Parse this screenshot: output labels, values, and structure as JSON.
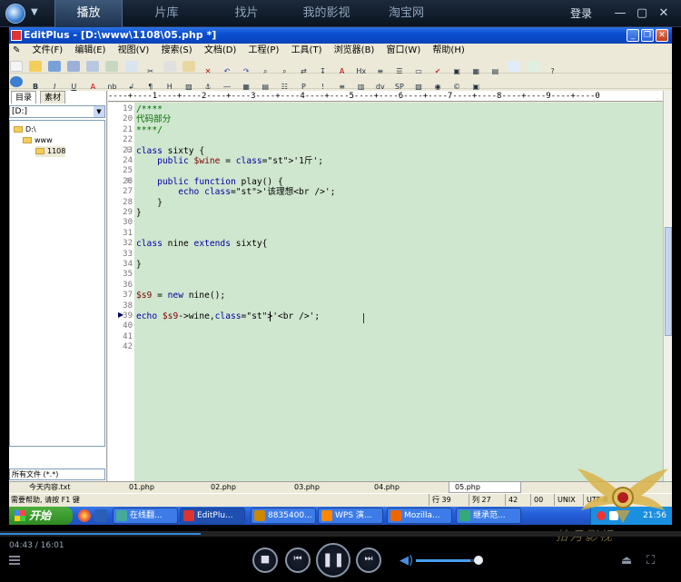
{
  "player": {
    "tabs": [
      {
        "label": "播放",
        "active": true
      },
      {
        "label": "片库"
      },
      {
        "label": "找片"
      },
      {
        "label": "我的影视"
      },
      {
        "label": "淘宝网"
      }
    ],
    "login_label": "登录",
    "elapsed": "04:43",
    "duration": "16:01",
    "timecode": "04:43 / 16:01",
    "progress_fraction": 0.295,
    "volume_fraction": 0.85
  },
  "editplus": {
    "title": "EditPlus - [D:\\www\\1108\\05.php *]",
    "menu": [
      "文件(F)",
      "编辑(E)",
      "视图(V)",
      "搜索(S)",
      "文档(D)",
      "工程(P)",
      "工具(T)",
      "浏览器(B)",
      "窗口(W)",
      "帮助(H)"
    ],
    "sidebar_tabs": [
      "目录",
      "素材"
    ],
    "drive": "[D:]",
    "tree": [
      "D:\\",
      "www",
      "1108"
    ],
    "filter": "所有文件 (*.*)",
    "ruler": "----+----1----+----2----+----3----+----4----+----5----+----6----+----7----+----8----+----9----+----0",
    "lines": [
      {
        "n": "19",
        "t": "/****"
      },
      {
        "n": "20",
        "t": "代码部分"
      },
      {
        "n": "21",
        "t": "****/"
      },
      {
        "n": "22",
        "t": ""
      },
      {
        "n": "23",
        "t": "class sixty {"
      },
      {
        "n": "24",
        "t": "    public $wine = '1斤';"
      },
      {
        "n": "25",
        "t": ""
      },
      {
        "n": "26",
        "t": "    public function play() {"
      },
      {
        "n": "27",
        "t": "        echo '该理想<br />';"
      },
      {
        "n": "28",
        "t": "    }"
      },
      {
        "n": "29",
        "t": "}"
      },
      {
        "n": "30",
        "t": ""
      },
      {
        "n": "31",
        "t": ""
      },
      {
        "n": "32",
        "t": "class nine extends sixty{"
      },
      {
        "n": "33",
        "t": ""
      },
      {
        "n": "34",
        "t": "}"
      },
      {
        "n": "35",
        "t": ""
      },
      {
        "n": "36",
        "t": ""
      },
      {
        "n": "37",
        "t": "$s9 = new nine();"
      },
      {
        "n": "38",
        "t": ""
      },
      {
        "n": "39",
        "t": "echo $s9->wine,'<br />'; "
      },
      {
        "n": "40",
        "t": ""
      },
      {
        "n": "41",
        "t": ""
      },
      {
        "n": "42",
        "t": ""
      }
    ],
    "doc_tabs": [
      "今天内容.txt",
      "01.php",
      "02.php",
      "03.php",
      "04.php",
      "05.php"
    ],
    "active_doc": "05.php",
    "status": {
      "help": "需要帮助, 请按 F1 键",
      "row": "行 39",
      "col": "列 27",
      "n1": "42",
      "n2": "00",
      "encoding": "UNIX",
      "charset": "UTF-8"
    }
  },
  "taskbar": {
    "start": "开始",
    "tasks": [
      "在线翻...",
      "EditPlu...",
      "8835400...",
      "WPS 演...",
      "Mozilla...",
      "继承范..."
    ],
    "clock": "21:56"
  },
  "watermark": "拾月影视",
  "colors": {
    "editor_bg": "#cfe6cf",
    "keyword": "#0000a0",
    "comment": "#007000",
    "string": "#c000c0",
    "player_accent": "#2f8ae0"
  }
}
